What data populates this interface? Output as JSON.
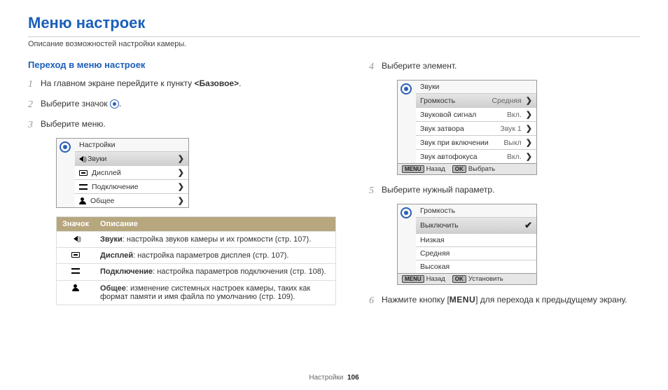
{
  "header": {
    "title": "Меню настроек",
    "subtitle": "Описание возможностей настройки камеры."
  },
  "left": {
    "section_heading": "Переход в меню настроек",
    "steps": {
      "s1_prefix": "На главном экране перейдите к пункту ",
      "s1_bold": "<Базовое>",
      "s1_suffix": ".",
      "s2_prefix": "Выберите значок ",
      "s2_suffix": ".",
      "s3": "Выберите меню."
    },
    "menu1": {
      "title": "Настройки",
      "rows": [
        {
          "label": "Звуки",
          "icon": "speaker",
          "selected": true
        },
        {
          "label": "Дисплей",
          "icon": "display",
          "selected": false
        },
        {
          "label": "Подключение",
          "icon": "connect",
          "selected": false
        },
        {
          "label": "Общее",
          "icon": "person",
          "selected": false
        }
      ]
    },
    "table": {
      "h1": "Значок",
      "h2": "Описание",
      "rows": [
        {
          "icon": "speaker",
          "b": "Звуки",
          "t": ": настройка звуков камеры и их громкости (стр. 107)."
        },
        {
          "icon": "display",
          "b": "Дисплей",
          "t": ": настройка параметров дисплея (стр. 107)."
        },
        {
          "icon": "connect",
          "b": "Подключение",
          "t": ": настройка параметров подключения (стр. 108)."
        },
        {
          "icon": "person",
          "b": "Общее",
          "t": ": изменение системных настроек камеры, таких как формат памяти и имя файла по умолчанию (стр. 109)."
        }
      ]
    }
  },
  "right": {
    "step4": "Выберите элемент.",
    "step5": "Выберите нужный параметр.",
    "step6_prefix": "Нажмите кнопку [",
    "step6_menu": "MENU",
    "step6_suffix": "] для перехода к предыдущему экрану.",
    "menu2": {
      "title": "Звуки",
      "rows": [
        {
          "label": "Громкость",
          "value": "Средняя",
          "selected": true
        },
        {
          "label": "Звуковой сигнал",
          "value": "Вкл.",
          "selected": false
        },
        {
          "label": "Звук затвора",
          "value": "Звук 1",
          "selected": false
        },
        {
          "label": "Звук при включении",
          "value": "Выкл",
          "selected": false
        },
        {
          "label": "Звук автофокуса",
          "value": "Вкл.",
          "selected": false
        }
      ],
      "footer_back_tag": "MENU",
      "footer_back": "Назад",
      "footer_ok_tag": "OK",
      "footer_ok": "Выбрать"
    },
    "menu3": {
      "title": "Громкость",
      "rows": [
        {
          "label": "Выключить",
          "selected": true,
          "check": true
        },
        {
          "label": "Низкая",
          "selected": false,
          "check": false
        },
        {
          "label": "Средняя",
          "selected": false,
          "check": false
        },
        {
          "label": "Высокая",
          "selected": false,
          "check": false
        }
      ],
      "footer_back_tag": "MENU",
      "footer_back": "Назад",
      "footer_ok_tag": "OK",
      "footer_ok": "Установить"
    }
  },
  "footer": {
    "label": "Настройки",
    "page": "106"
  }
}
